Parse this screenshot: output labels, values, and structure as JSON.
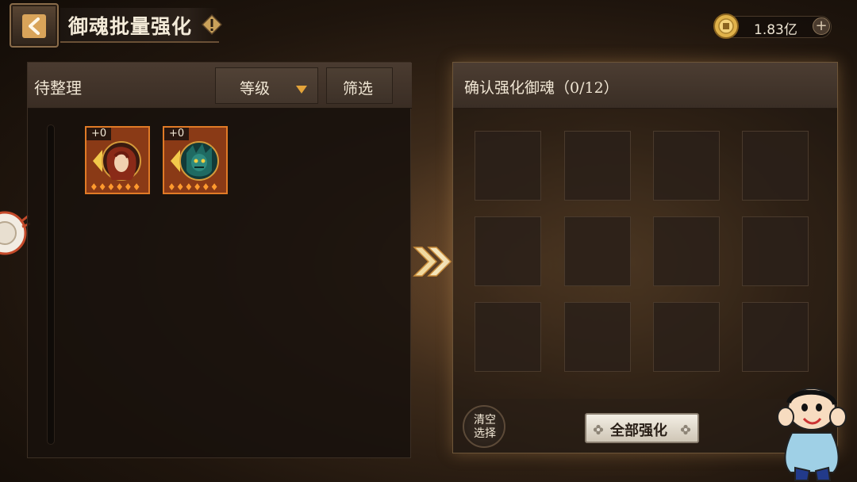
{
  "header": {
    "title": "御魂批量强化",
    "currency_value": "1.83亿"
  },
  "left_panel": {
    "title": "待整理",
    "sort_label": "等级",
    "filter_label": "筛选",
    "items": [
      {
        "level": "+0",
        "stars": "♦♦♦♦♦♦",
        "portrait": "red-haired-character"
      },
      {
        "level": "+0",
        "stars": "♦♦♦♦♦♦",
        "portrait": "teal-demon-character"
      }
    ]
  },
  "right_panel": {
    "title": "确认强化御魂（0/12）",
    "slot_count": 12,
    "clear_label": "清空选择",
    "enhance_all_label": "全部强化"
  },
  "colors": {
    "accent": "#e07a26",
    "gold": "#d9a45a",
    "button_light": "#f3eee4"
  },
  "icons": [
    "back-arrow-icon",
    "info-icon",
    "coin-icon",
    "plus-icon",
    "caret-down-icon",
    "double-chevron-right-icon",
    "flower-icon"
  ]
}
